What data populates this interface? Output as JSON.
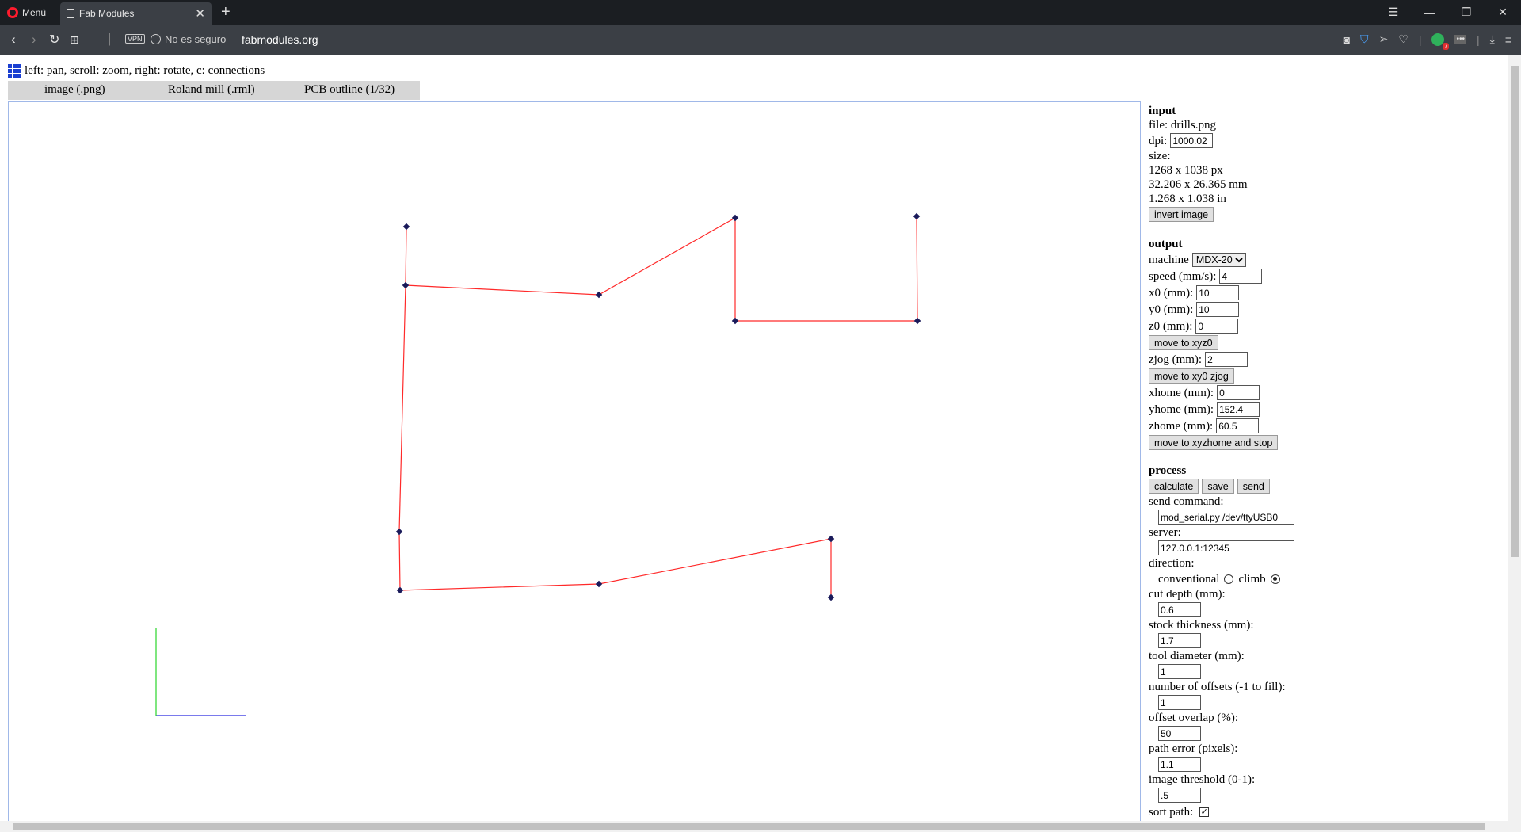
{
  "browser": {
    "menu_label": "Menú",
    "tab_title": "Fab Modules",
    "security_text": "No es seguro",
    "url": "fabmodules.org",
    "vpn_label": "VPN",
    "extension_badge": "7"
  },
  "help_text": "left: pan, scroll: zoom, right: rotate, c: connections",
  "tabs": {
    "image": "image (.png)",
    "rml": "Roland mill (.rml)",
    "outline": "PCB outline (1/32)"
  },
  "input": {
    "heading": "input",
    "file": "file: drills.png",
    "dpi_label": "dpi:",
    "dpi_value": "1000.02",
    "size_label": "size:",
    "size_px": "1268 x 1038 px",
    "size_mm": "32.206 x 26.365 mm",
    "size_in": "1.268 x 1.038 in",
    "invert_button": "invert image"
  },
  "output": {
    "heading": "output",
    "machine_label": "machine",
    "machine_value": "MDX-20",
    "speed_label": "speed (mm/s):",
    "speed_value": "4",
    "x0_label": "x0 (mm):",
    "x0_value": "10",
    "y0_label": "y0 (mm):",
    "y0_value": "10",
    "z0_label": "z0 (mm):",
    "z0_value": "0",
    "move_xyz0_button": "move to xyz0",
    "zjog_label": "zjog (mm):",
    "zjog_value": "2",
    "move_xy0_button": "move to xy0 zjog",
    "xhome_label": "xhome (mm):",
    "xhome_value": "0",
    "yhome_label": "yhome (mm):",
    "yhome_value": "152.4",
    "zhome_label": "zhome (mm):",
    "zhome_value": "60.5",
    "move_home_button": "move to xyzhome and stop"
  },
  "process": {
    "heading": "process",
    "calculate_button": "calculate",
    "save_button": "save",
    "send_button": "send",
    "send_command_label": "send command:",
    "send_command_value": "mod_serial.py /dev/ttyUSB0",
    "server_label": "server:",
    "server_value": "127.0.0.1:12345",
    "direction_label": "direction:",
    "conventional_label": "conventional",
    "climb_label": "climb",
    "direction_selected": "climb",
    "cut_depth_label": "cut depth (mm):",
    "cut_depth_value": "0.6",
    "stock_label": "stock thickness (mm):",
    "stock_value": "1.7",
    "tool_label": "tool diameter (mm):",
    "tool_value": "1",
    "offsets_label": "number of offsets (-1 to fill):",
    "offsets_value": "1",
    "overlap_label": "offset overlap (%):",
    "overlap_value": "50",
    "path_error_label": "path error (pixels):",
    "path_error_value": "1.1",
    "threshold_label": "image threshold (0-1):",
    "threshold_value": ".5",
    "sort_label": "sort path:",
    "sort_checked": true
  },
  "toolpath": {
    "line_color": "#ff2a2a",
    "marker_color": "#1a1a5a",
    "x_axis_color": "#2a2ae0",
    "y_axis_color": "#2ad42a"
  }
}
